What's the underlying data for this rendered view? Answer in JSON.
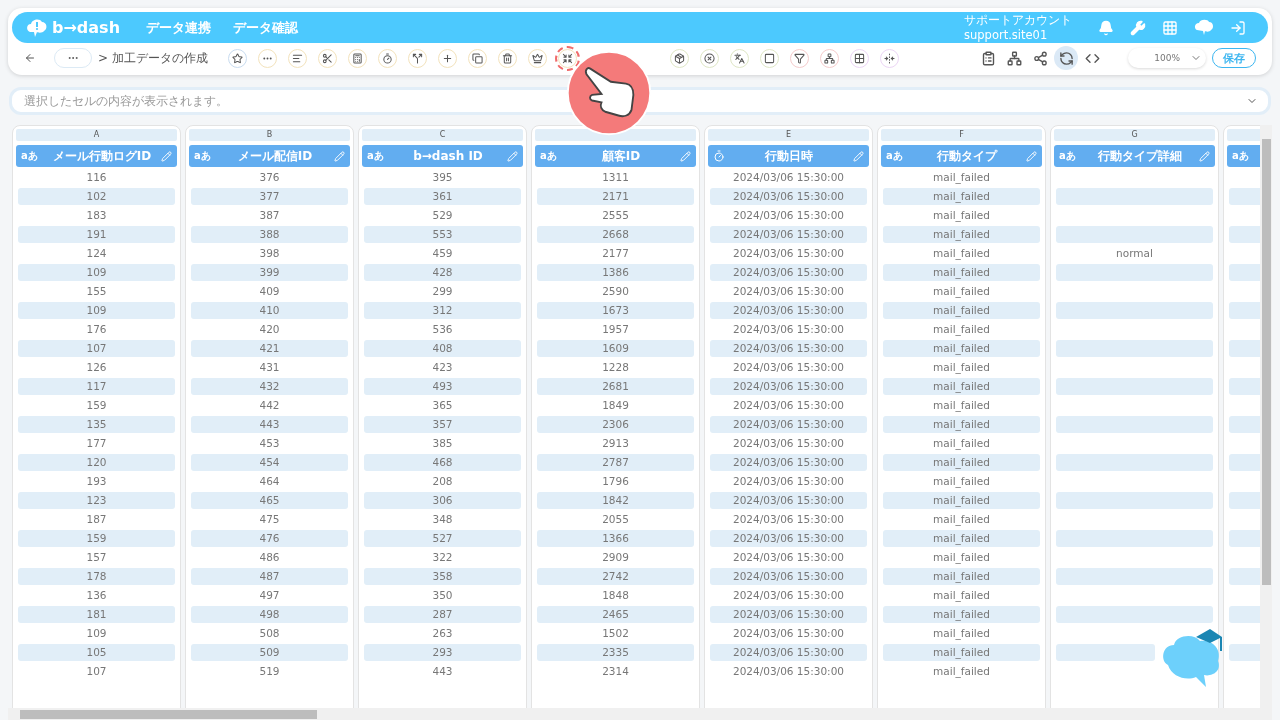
{
  "header": {
    "logo": "b→dash",
    "nav": [
      {
        "label": "データ連携"
      },
      {
        "label": "データ確認"
      }
    ],
    "account": {
      "name": "サポートアカウント",
      "id": "support.site01"
    }
  },
  "breadcrumb": {
    "current": "> 加工データの作成"
  },
  "tools": [
    {
      "kind": "star",
      "color": "#c9dcef",
      "highlighted": false
    },
    {
      "kind": "dots",
      "color": "#f3e3bd",
      "highlighted": false
    },
    {
      "kind": "lines",
      "color": "#f3e3bd",
      "highlighted": false
    },
    {
      "kind": "scissors",
      "color": "#f3e3bd",
      "highlighted": false
    },
    {
      "kind": "calc",
      "color": "#f3e3bd",
      "highlighted": false
    },
    {
      "kind": "timer",
      "color": "#f3e3bd",
      "highlighted": false
    },
    {
      "kind": "split",
      "color": "#f3e3bd",
      "highlighted": false
    },
    {
      "kind": "plus",
      "color": "#f3e3bd",
      "highlighted": false
    },
    {
      "kind": "copy",
      "color": "#f3e3bd",
      "highlighted": false
    },
    {
      "kind": "trash",
      "color": "#f3e3bd",
      "highlighted": false
    },
    {
      "kind": "crown",
      "color": "#f3e3bd",
      "highlighted": false
    },
    {
      "kind": "shrink",
      "color": "#f3e3bd",
      "highlighted": true
    },
    {
      "kind": "gap"
    },
    {
      "kind": "package",
      "color": "#dfe7c6",
      "highlighted": false
    },
    {
      "kind": "xcircle",
      "color": "#dfe7c6",
      "highlighted": false
    },
    {
      "kind": "translate",
      "color": "#dfe7c6",
      "highlighted": false
    },
    {
      "kind": "square",
      "color": "#dfe7c6",
      "highlighted": false
    },
    {
      "kind": "filter",
      "color": "#f5cccc",
      "highlighted": false
    },
    {
      "kind": "network",
      "color": "#f5cccc",
      "highlighted": false
    },
    {
      "kind": "grid",
      "color": "#ecd6f5",
      "highlighted": false
    },
    {
      "kind": "fold",
      "color": "#ecd6f5",
      "highlighted": false
    }
  ],
  "right_tools": [
    {
      "kind": "clipboard",
      "selected": false
    },
    {
      "kind": "network",
      "selected": false
    },
    {
      "kind": "share",
      "selected": false
    },
    {
      "kind": "refresh",
      "selected": true
    },
    {
      "kind": "code",
      "selected": false
    }
  ],
  "zoom": {
    "value": "100%"
  },
  "save_button": "保存",
  "cell_field": {
    "placeholder": "選択したセルの内容が表示されます。"
  },
  "columns": [
    {
      "letter": "A",
      "kind": "text",
      "type_label": "aあ",
      "name": "メール行動ログID",
      "cells": [
        "116",
        "102",
        "183",
        "191",
        "124",
        "109",
        "155",
        "109",
        "176",
        "107",
        "126",
        "117",
        "159",
        "135",
        "177",
        "120",
        "193",
        "123",
        "187",
        "159",
        "157",
        "178",
        "136",
        "181",
        "109",
        "105",
        "107"
      ]
    },
    {
      "letter": "B",
      "kind": "text",
      "type_label": "aあ",
      "name": "メール配信ID",
      "cells": [
        "376",
        "377",
        "387",
        "388",
        "398",
        "399",
        "409",
        "410",
        "420",
        "421",
        "431",
        "432",
        "442",
        "443",
        "453",
        "454",
        "464",
        "465",
        "475",
        "476",
        "486",
        "487",
        "497",
        "498",
        "508",
        "509",
        "519"
      ]
    },
    {
      "letter": "C",
      "kind": "text",
      "type_label": "aあ",
      "name": "b→dash ID",
      "cells": [
        "395",
        "361",
        "529",
        "553",
        "459",
        "428",
        "299",
        "312",
        "536",
        "408",
        "423",
        "493",
        "365",
        "357",
        "385",
        "468",
        "208",
        "306",
        "348",
        "527",
        "322",
        "358",
        "350",
        "287",
        "263",
        "293",
        "443"
      ]
    },
    {
      "kind": "text",
      "type_label": "aあ",
      "name": "顧客ID",
      "cells": [
        "1311",
        "2171",
        "2555",
        "2668",
        "2177",
        "1386",
        "2590",
        "1673",
        "1957",
        "1609",
        "1228",
        "2681",
        "1849",
        "2306",
        "2913",
        "2787",
        "1796",
        "1842",
        "2055",
        "1366",
        "2909",
        "2742",
        "1848",
        "2465",
        "1502",
        "2335",
        "2314"
      ]
    },
    {
      "letter": "E",
      "kind": "datetime",
      "name": "行動日時",
      "cells": [
        "2024/03/06 15:30:00",
        "2024/03/06 15:30:00",
        "2024/03/06 15:30:00",
        "2024/03/06 15:30:00",
        "2024/03/06 15:30:00",
        "2024/03/06 15:30:00",
        "2024/03/06 15:30:00",
        "2024/03/06 15:30:00",
        "2024/03/06 15:30:00",
        "2024/03/06 15:30:00",
        "2024/03/06 15:30:00",
        "2024/03/06 15:30:00",
        "2024/03/06 15:30:00",
        "2024/03/06 15:30:00",
        "2024/03/06 15:30:00",
        "2024/03/06 15:30:00",
        "2024/03/06 15:30:00",
        "2024/03/06 15:30:00",
        "2024/03/06 15:30:00",
        "2024/03/06 15:30:00",
        "2024/03/06 15:30:00",
        "2024/03/06 15:30:00",
        "2024/03/06 15:30:00",
        "2024/03/06 15:30:00",
        "2024/03/06 15:30:00",
        "2024/03/06 15:30:00",
        "2024/03/06 15:30:00"
      ]
    },
    {
      "letter": "F",
      "kind": "text",
      "type_label": "aあ",
      "name": "行動タイプ",
      "cells": [
        "mail_failed",
        "mail_failed",
        "mail_failed",
        "mail_failed",
        "mail_failed",
        "mail_failed",
        "mail_failed",
        "mail_failed",
        "mail_failed",
        "mail_failed",
        "mail_failed",
        "mail_failed",
        "mail_failed",
        "mail_failed",
        "mail_failed",
        "mail_failed",
        "mail_failed",
        "mail_failed",
        "mail_failed",
        "mail_failed",
        "mail_failed",
        "mail_failed",
        "mail_failed",
        "mail_failed",
        "mail_failed",
        "mail_failed",
        "mail_failed"
      ]
    },
    {
      "letter": "G",
      "kind": "text",
      "type_label": "aあ",
      "name": "行動タイプ詳細",
      "cells": [
        null,
        null,
        null,
        null,
        "normal",
        null,
        null,
        null,
        null,
        null,
        null,
        null,
        null,
        null,
        null,
        null,
        null,
        null,
        null,
        null,
        null,
        null,
        null,
        null,
        null,
        null,
        null
      ]
    },
    {
      "kind": "text",
      "type_label": "aあ"
    }
  ]
}
